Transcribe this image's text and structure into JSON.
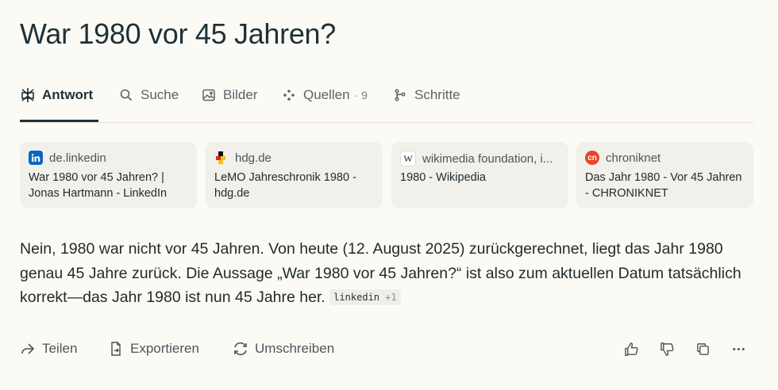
{
  "query": {
    "title": "War 1980 vor 45 Jahren?"
  },
  "tabs": [
    {
      "label": "Antwort",
      "icon": "perplexity-logo-icon"
    },
    {
      "label": "Suche",
      "icon": "search-icon"
    },
    {
      "label": "Bilder",
      "icon": "image-icon"
    },
    {
      "label": "Quellen",
      "icon": "sources-icon",
      "count": "· 9"
    },
    {
      "label": "Schritte",
      "icon": "steps-icon"
    }
  ],
  "sources": [
    {
      "domain": "de.linkedin",
      "title": "War 1980 vor 45 Jahren? | Jonas Hartmann - LinkedIn",
      "icon": "linkedin-icon",
      "color": "#0a66c2"
    },
    {
      "domain": "hdg.de",
      "title": "LeMO Jahreschronik 1980 - hdg.de",
      "icon": "hdg-icon",
      "color": "#e0b000"
    },
    {
      "domain": "wikimedia foundation, i...",
      "title": "1980 - Wikipedia",
      "icon": "wikipedia-icon",
      "color": "#ffffff"
    },
    {
      "domain": "chroniknet",
      "title": "Das Jahr 1980 - Vor 45 Jahren - CHRONIKNET",
      "icon": "chroniknet-icon",
      "color": "#e8452c"
    }
  ],
  "answer": {
    "text": "Nein, 1980 war nicht vor 45 Jahren. Von heute (12. August 2025) zurückgerechnet, liegt das Jahr 1980 genau 45 Jahre zurück. Die Aussage „War 1980 vor 45 Jahren?“ ist also zum aktuellen Datum tatsächlich korrekt—das Jahr 1980 ist nun 45 Jahre her.",
    "citation": {
      "label": "linkedin",
      "more": "+1"
    }
  },
  "actions": {
    "share": "Teilen",
    "export": "Exportieren",
    "rewrite": "Umschreiben"
  }
}
